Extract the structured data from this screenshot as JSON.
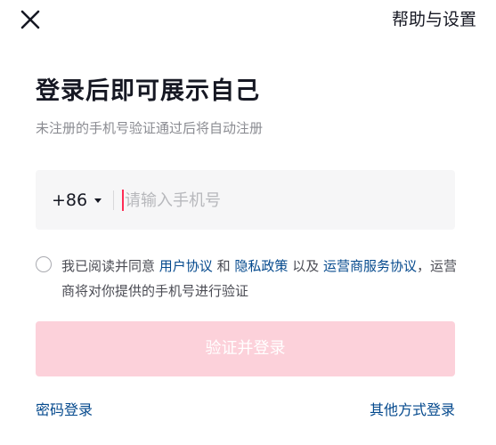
{
  "header": {
    "close_icon": "close-icon",
    "help_label": "帮助与设置"
  },
  "main": {
    "title": "登录后即可展示自己",
    "subtitle": "未注册的手机号验证通过后将自动注册"
  },
  "phone": {
    "country_code": "+86",
    "placeholder": "请输入手机号",
    "value": ""
  },
  "agreement": {
    "prefix": "我已阅读并同意",
    "user_agreement": "用户协议",
    "and": "和",
    "privacy_policy": "隐私政策",
    "and_also": "以及",
    "operator_agreement": "运营商服务协议",
    "suffix": "，运营商将对你提供的手机号进行验证",
    "checked": false
  },
  "actions": {
    "login_label": "验证并登录",
    "password_login": "密码登录",
    "other_login": "其他方式登录"
  },
  "colors": {
    "accent_pink": "#fe2c55",
    "disabled_button": "#fcd1da",
    "link_blue": "#04498d",
    "muted_text": "#8a8b91"
  }
}
